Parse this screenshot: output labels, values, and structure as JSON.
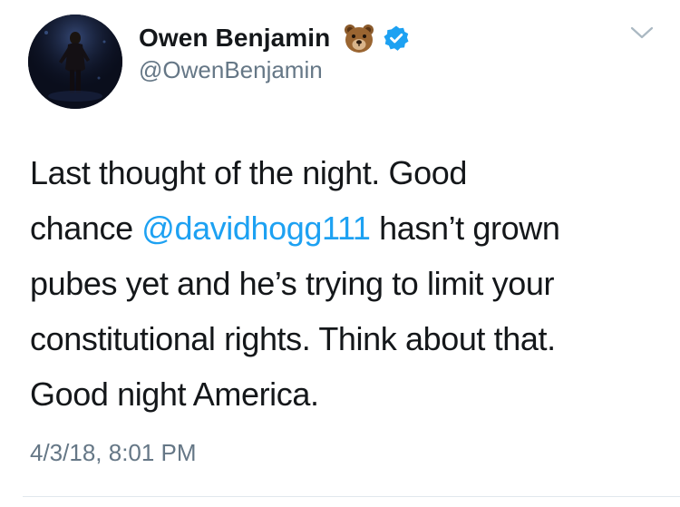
{
  "tweet": {
    "display_name": "Owen Benjamin",
    "name_emoji": "🐻",
    "handle": "@OwenBenjamin",
    "text_lines": [
      [
        "Last thought of the night. Good"
      ],
      [
        "chance ",
        "@davidhogg111",
        " hasn’t grown"
      ],
      [
        "pubes yet and he’s trying to limit your"
      ],
      [
        "constitutional rights. Think about that."
      ],
      [
        "Good night America."
      ]
    ],
    "mention": "@davidhogg111",
    "timestamp": "4/3/18, 8:01 PM",
    "icons": {
      "verified": "verified-badge-icon",
      "menu": "chevron-down-icon",
      "emoji": "bear-face-icon"
    }
  },
  "colors": {
    "text": "#14171a",
    "secondary": "#657786",
    "link": "#1da1f2",
    "verified": "#1da1f2",
    "divider": "#e1e8ed"
  }
}
